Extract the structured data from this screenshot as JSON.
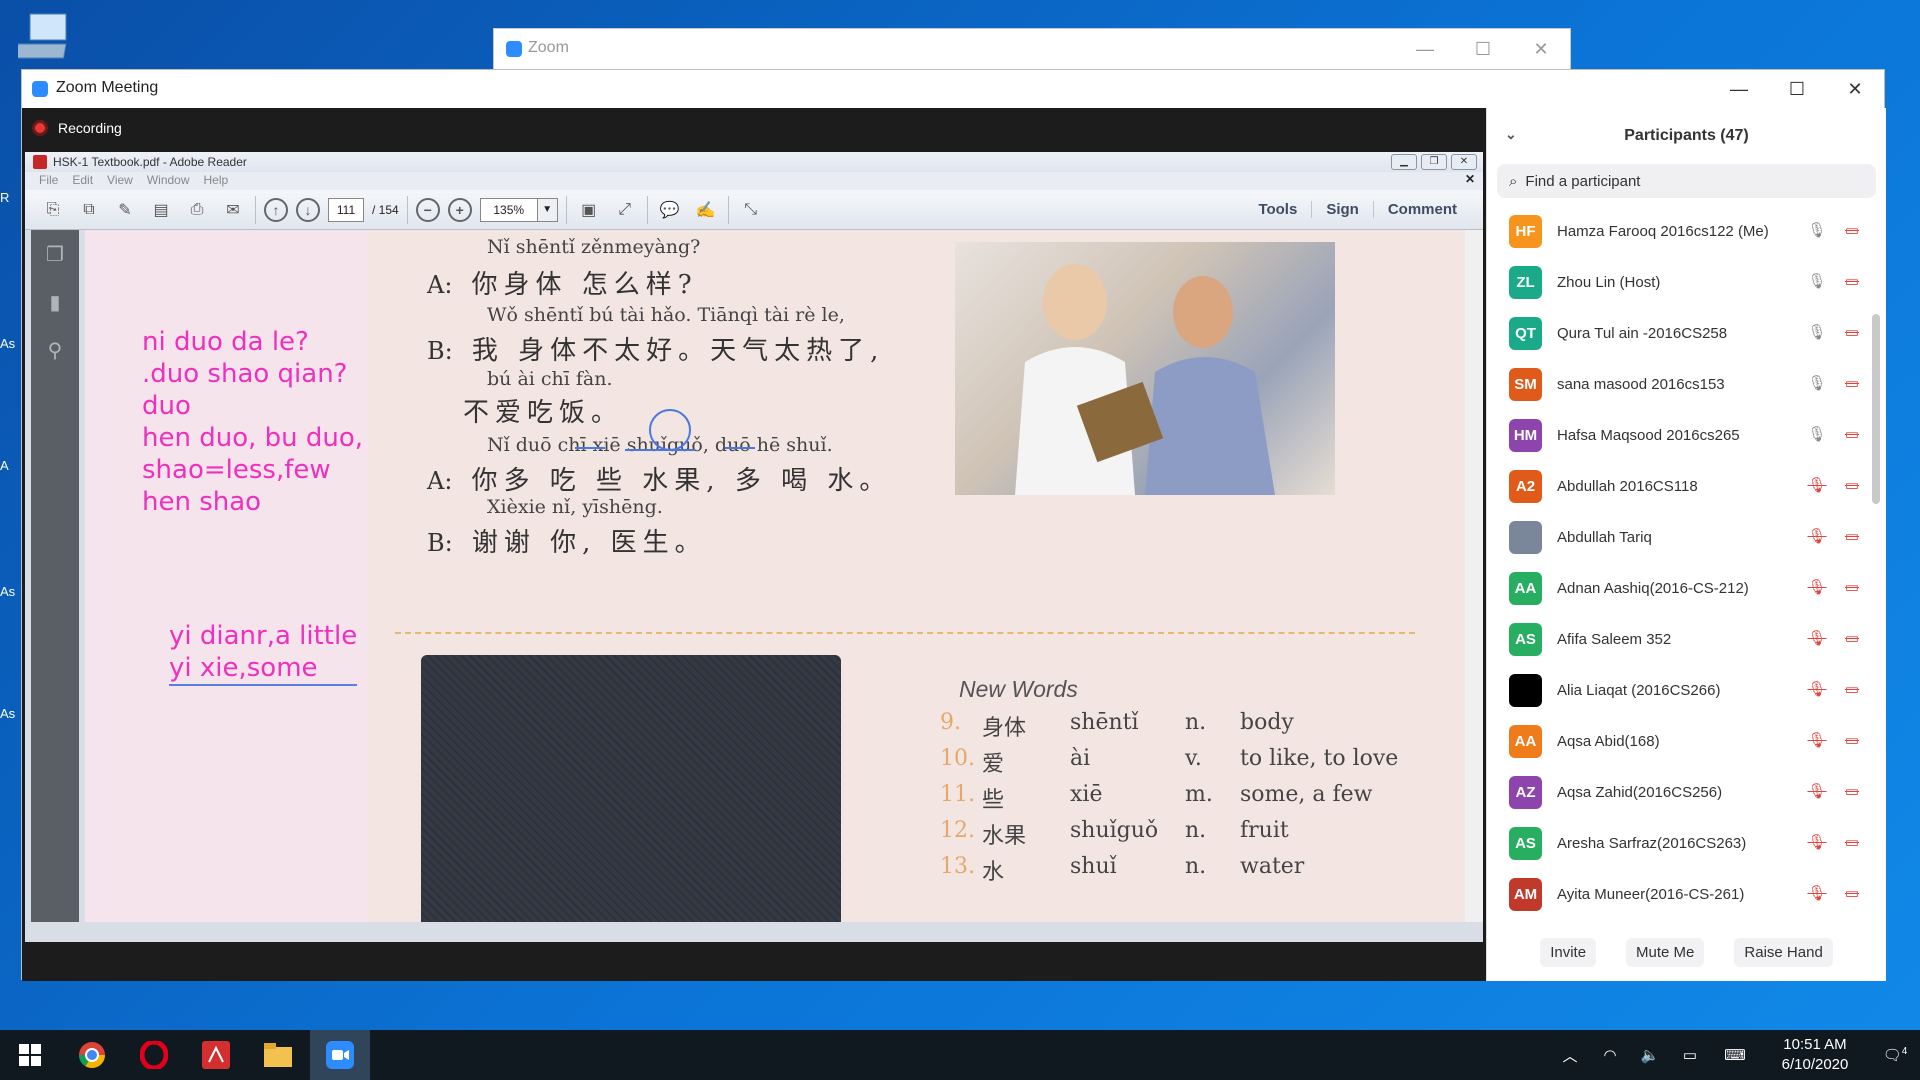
{
  "zoom_back": {
    "title": "Zoom"
  },
  "zoom_main": {
    "title": "Zoom Meeting",
    "recording_label": "Recording"
  },
  "adobe": {
    "title": "HSK-1 Textbook.pdf - Adobe Reader",
    "menu": [
      "File",
      "Edit",
      "View",
      "Window",
      "Help"
    ],
    "page_current": "111",
    "page_total": "/ 154",
    "zoom": "135%",
    "right_buttons": [
      "Tools",
      "Sign",
      "Comment"
    ]
  },
  "document": {
    "dialogue": [
      {
        "pinyin": "Nǐ shēntǐ zěnmeyàng?",
        "speaker": "A:",
        "hanzi": "你身体 怎么样?"
      },
      {
        "pinyin": "Wǒ shēntǐ bú tài hǎo.  Tiānqì tài rè  le,",
        "speaker": "B:",
        "hanzi": "我 身体不太好。天气太热了,"
      },
      {
        "pinyin": "bú  ài chī fàn.",
        "speaker": "",
        "hanzi": "不爱吃饭。"
      },
      {
        "pinyin": "Nǐ duō chī  xiē shuǐguǒ, duō  hē shuǐ.",
        "speaker": "A:",
        "hanzi": "你多 吃 些 水果, 多 喝 水。"
      },
      {
        "pinyin": "Xièxie  nǐ,  yīshēng.",
        "speaker": "B:",
        "hanzi": "谢谢 你, 医生。"
      }
    ],
    "notes": [
      "ni duo da le?",
      ".duo shao qian?",
      "duo",
      "hen duo, bu duo,",
      "shao=less,few",
      "hen shao"
    ],
    "notes2": [
      "yi dianr,a little",
      "yi xie,some"
    ],
    "new_words_title": "New Words",
    "new_words": [
      {
        "num": "9.",
        "hanzi": "身体",
        "pinyin": "shēntǐ",
        "pos": "n.",
        "meaning": "body"
      },
      {
        "num": "10.",
        "hanzi": "爱",
        "pinyin": "ài",
        "pos": "v.",
        "meaning": "to like, to love"
      },
      {
        "num": "11.",
        "hanzi": "些",
        "pinyin": "xiē",
        "pos": "m.",
        "meaning": "some, a few"
      },
      {
        "num": "12.",
        "hanzi": "水果",
        "pinyin": "shuǐguǒ",
        "pos": "n.",
        "meaning": "fruit"
      },
      {
        "num": "13.",
        "hanzi": "水",
        "pinyin": "shuǐ",
        "pos": "n.",
        "meaning": "water"
      }
    ]
  },
  "participants": {
    "header": "Participants (47)",
    "search_placeholder": "Find a participant",
    "list": [
      {
        "initials": "HF",
        "name": "Hamza Farooq 2016cs122 (Me)",
        "color": "#f7941d",
        "muted": false
      },
      {
        "initials": "ZL",
        "name": "Zhou Lin (Host)",
        "color": "#1aaa8a",
        "muted": false
      },
      {
        "initials": "QT",
        "name": "Qura Tul ain -2016CS258",
        "color": "#1aaa8a",
        "muted": false
      },
      {
        "initials": "SM",
        "name": "sana masood 2016cs153",
        "color": "#e05a1a",
        "muted": false
      },
      {
        "initials": "HM",
        "name": "Hafsa Maqsood 2016cs265",
        "color": "#8e44ad",
        "muted": false
      },
      {
        "initials": "A2",
        "name": "Abdullah 2016CS118",
        "color": "#e05a1a",
        "muted": true
      },
      {
        "initials": "",
        "name": "Abdullah Tariq",
        "color": "#7a8699",
        "muted": true
      },
      {
        "initials": "AA",
        "name": "Adnan Aashiq(2016-CS-212)",
        "color": "#27ae60",
        "muted": true
      },
      {
        "initials": "AS",
        "name": "Afifa Saleem 352",
        "color": "#27ae60",
        "muted": true
      },
      {
        "initials": "",
        "name": "Alia Liaqat (2016CS266)",
        "color": "#000000",
        "muted": true
      },
      {
        "initials": "AA",
        "name": "Aqsa Abid(168)",
        "color": "#f07b1a",
        "muted": true
      },
      {
        "initials": "AZ",
        "name": "Aqsa Zahid(2016CS256)",
        "color": "#8e44ad",
        "muted": true
      },
      {
        "initials": "AS",
        "name": "Aresha Sarfraz(2016CS263)",
        "color": "#27ae60",
        "muted": true
      },
      {
        "initials": "AM",
        "name": "Ayita Muneer(2016-CS-261)",
        "color": "#c0392b",
        "muted": true
      }
    ],
    "buttons": {
      "invite": "Invite",
      "mute": "Mute Me",
      "raise": "Raise Hand"
    }
  },
  "taskbar": {
    "time": "10:51 AM",
    "date": "6/10/2020",
    "notif_count": "4"
  }
}
